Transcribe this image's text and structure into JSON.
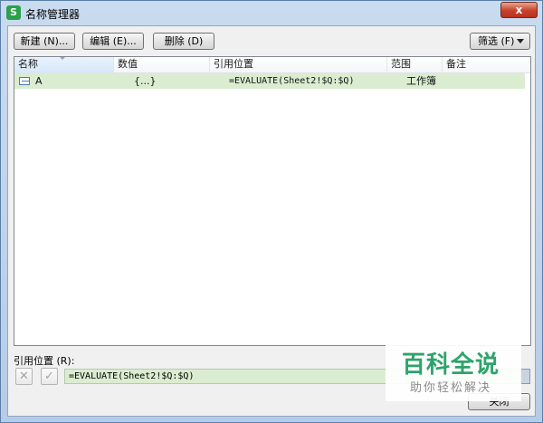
{
  "window": {
    "title": "名称管理器",
    "app_icon_letter": "S",
    "close_symbol": "x"
  },
  "toolbar": {
    "new_label": "新建 (N)...",
    "edit_label": "编辑 (E)...",
    "delete_label": "删除 (D)",
    "filter_label": "筛选 (F)"
  },
  "table": {
    "columns": [
      "名称",
      "数值",
      "引用位置",
      "范围",
      "备注"
    ],
    "rows": [
      {
        "name": "A",
        "value": "{...}",
        "ref": "=EVALUATE(Sheet2!$Q:$Q)",
        "scope": "工作簿",
        "comment": ""
      }
    ]
  },
  "ref_section": {
    "label": "引用位置 (R):",
    "value": "=EVALUATE(Sheet2!$Q:$Q)",
    "cancel_symbol": "✕",
    "confirm_symbol": "✓"
  },
  "footer": {
    "close_label": "关闭"
  },
  "watermark": {
    "main": "百科全说",
    "sub": "助你轻松解决"
  },
  "colors": {
    "accent_green": "#2ea36b",
    "selected_row": "#daedd0",
    "title_close": "#c7402a"
  }
}
